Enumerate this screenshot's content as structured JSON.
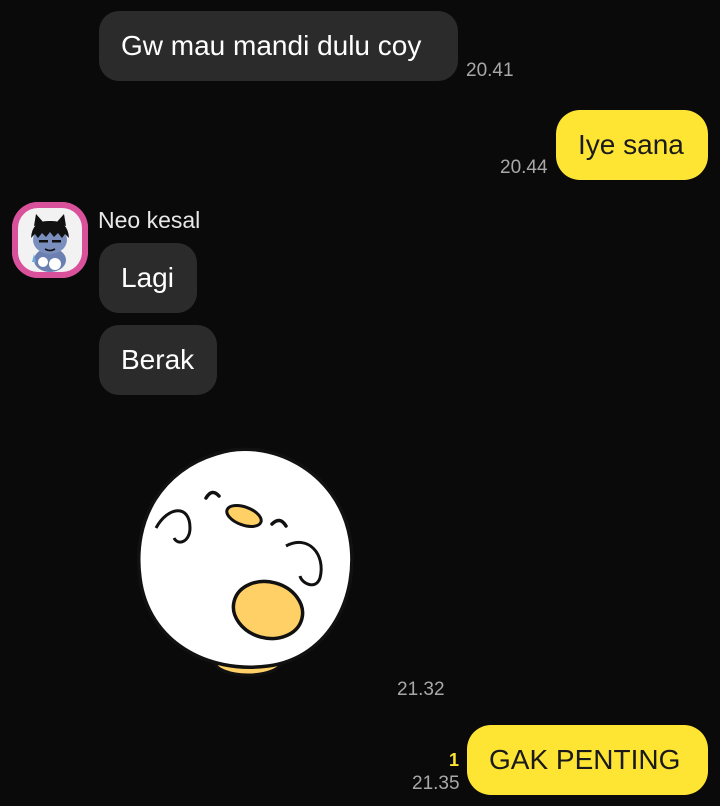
{
  "messages": [
    {
      "id": "m1",
      "direction": "incoming",
      "text": "Gw mau mandi dulu coy",
      "time": "20.41"
    },
    {
      "id": "m2",
      "direction": "outgoing",
      "text": "Iye sana",
      "time": "20.44"
    },
    {
      "id": "m3",
      "direction": "incoming",
      "sender": "Neo kesal",
      "text": "Lagi"
    },
    {
      "id": "m4",
      "direction": "incoming",
      "text": "Berak"
    },
    {
      "id": "m5",
      "direction": "incoming",
      "type": "sticker",
      "sticker": "duck-sticker",
      "time": "21.32"
    },
    {
      "id": "m6",
      "direction": "outgoing",
      "text": "GAK PENTING",
      "time": "21.35",
      "unread_count": "1"
    }
  ],
  "colors": {
    "background": "#0a0a0a",
    "incoming_bubble": "#2b2b2b",
    "outgoing_bubble": "#fee534",
    "avatar_bg": "#d9509b",
    "timestamp": "#a8a8a8",
    "unread": "#fee534"
  },
  "icons": {
    "avatar": "cat-character-avatar",
    "sticker": "duck-sticker"
  }
}
